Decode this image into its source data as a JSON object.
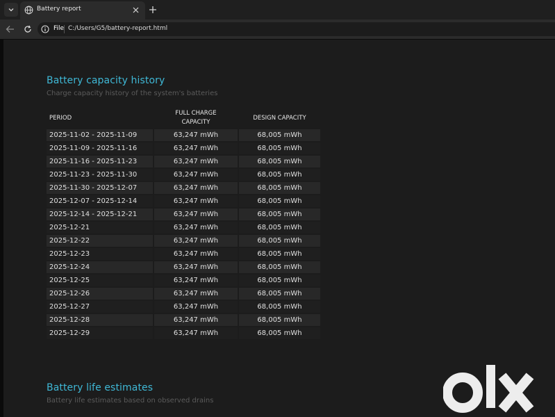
{
  "browser": {
    "tab_title": "Battery report",
    "scheme_label": "File",
    "url": "C:/Users/G5/battery-report.html"
  },
  "capacity_history": {
    "title": "Battery capacity history",
    "subtitle": "Charge capacity history of the system's batteries",
    "headers": {
      "period": "PERIOD",
      "full_charge_line1": "FULL CHARGE",
      "full_charge_line2": "CAPACITY",
      "design": "DESIGN CAPACITY"
    },
    "rows": [
      {
        "period": "2025-11-02 - 2025-11-09",
        "full": "63,247 mWh",
        "design": "68,005 mWh"
      },
      {
        "period": "2025-11-09 - 2025-11-16",
        "full": "63,247 mWh",
        "design": "68,005 mWh"
      },
      {
        "period": "2025-11-16 - 2025-11-23",
        "full": "63,247 mWh",
        "design": "68,005 mWh"
      },
      {
        "period": "2025-11-23 - 2025-11-30",
        "full": "63,247 mWh",
        "design": "68,005 mWh"
      },
      {
        "period": "2025-11-30 - 2025-12-07",
        "full": "63,247 mWh",
        "design": "68,005 mWh"
      },
      {
        "period": "2025-12-07 - 2025-12-14",
        "full": "63,247 mWh",
        "design": "68,005 mWh"
      },
      {
        "period": "2025-12-14 - 2025-12-21",
        "full": "63,247 mWh",
        "design": "68,005 mWh"
      },
      {
        "period": "2025-12-21",
        "full": "63,247 mWh",
        "design": "68,005 mWh"
      },
      {
        "period": "2025-12-22",
        "full": "63,247 mWh",
        "design": "68,005 mWh"
      },
      {
        "period": "2025-12-23",
        "full": "63,247 mWh",
        "design": "68,005 mWh"
      },
      {
        "period": "2025-12-24",
        "full": "63,247 mWh",
        "design": "68,005 mWh"
      },
      {
        "period": "2025-12-25",
        "full": "63,247 mWh",
        "design": "68,005 mWh"
      },
      {
        "period": "2025-12-26",
        "full": "63,247 mWh",
        "design": "68,005 mWh"
      },
      {
        "period": "2025-12-27",
        "full": "63,247 mWh",
        "design": "68,005 mWh"
      },
      {
        "period": "2025-12-28",
        "full": "63,247 mWh",
        "design": "68,005 mWh"
      },
      {
        "period": "2025-12-29",
        "full": "63,247 mWh",
        "design": "68,005 mWh"
      }
    ]
  },
  "life_estimates": {
    "title": "Battery life estimates",
    "subtitle": "Battery life estimates based on observed drains"
  },
  "watermark": {
    "text": "olx"
  },
  "colors": {
    "accent": "#3fb8d6",
    "page_bg": "#1c1c1c",
    "row_alt": "#282828"
  }
}
